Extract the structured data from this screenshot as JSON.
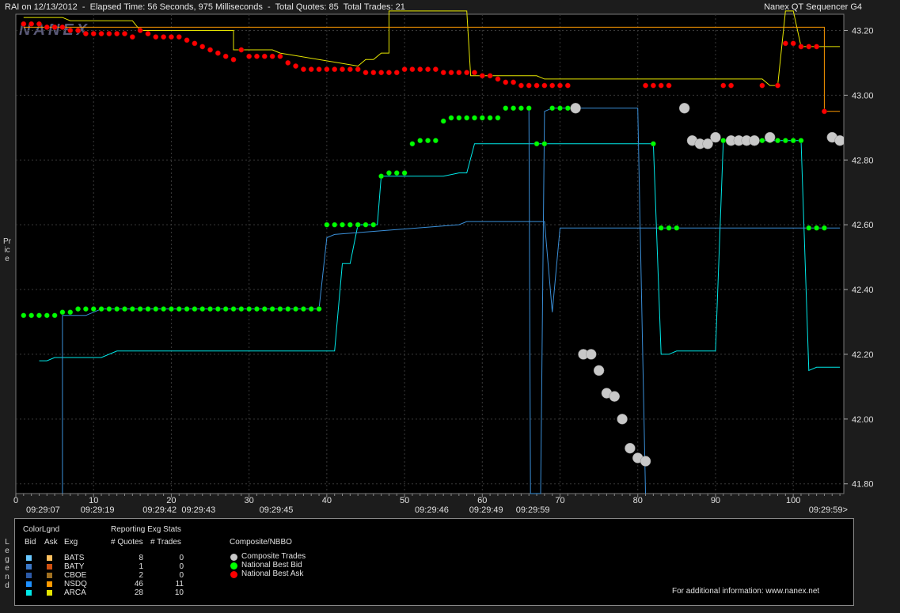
{
  "header": {
    "left": "RAI on 12/13/2012  -  Elapsed Time: 56 Seconds, 975 Milliseconds  -  Total Quotes: 85  Total Trades: 21",
    "right": "Nanex QT Sequencer G4"
  },
  "watermark": "NANEX",
  "side_labels": {
    "price": "Price",
    "legend": "Legend"
  },
  "chart_data": {
    "type": "line",
    "ylim": [
      41.77,
      43.25
    ],
    "xlim": [
      0,
      106.5
    ],
    "y_ticks": [
      "43.20",
      "43.00",
      "42.80",
      "42.60",
      "42.40",
      "42.20",
      "42.00",
      "41.80"
    ],
    "x_ticks": [
      "0",
      "10",
      "20",
      "30",
      "40",
      "50",
      "60",
      "70",
      "80",
      "90",
      "100"
    ],
    "time_labels": [
      {
        "x": 3.5,
        "label": "09:29:07"
      },
      {
        "x": 10.5,
        "label": "09:29:19"
      },
      {
        "x": 18.5,
        "label": "09:29:42"
      },
      {
        "x": 23.5,
        "label": "09:29:43"
      },
      {
        "x": 33.5,
        "label": "09:29:45"
      },
      {
        "x": 53.5,
        "label": "09:29:46"
      },
      {
        "x": 60.5,
        "label": "09:29:49"
      },
      {
        "x": 66.5,
        "label": "09:29:59"
      },
      {
        "x": 104.5,
        "label": "09:29:59>"
      }
    ],
    "national_best_ask": {
      "name": "National Best Ask",
      "color": "#ff0000",
      "points": [
        [
          1,
          43.22
        ],
        [
          2,
          43.22
        ],
        [
          3,
          43.22
        ],
        [
          4,
          43.21
        ],
        [
          5,
          43.21
        ],
        [
          6,
          43.21
        ],
        [
          7,
          43.2
        ],
        [
          8,
          43.2
        ],
        [
          9,
          43.19
        ],
        [
          10,
          43.19
        ],
        [
          11,
          43.19
        ],
        [
          12,
          43.19
        ],
        [
          13,
          43.19
        ],
        [
          14,
          43.19
        ],
        [
          15,
          43.18
        ],
        [
          16,
          43.2
        ],
        [
          17,
          43.19
        ],
        [
          18,
          43.18
        ],
        [
          19,
          43.18
        ],
        [
          20,
          43.18
        ],
        [
          21,
          43.18
        ],
        [
          22,
          43.17
        ],
        [
          23,
          43.16
        ],
        [
          24,
          43.15
        ],
        [
          25,
          43.14
        ],
        [
          26,
          43.13
        ],
        [
          27,
          43.12
        ],
        [
          28,
          43.11
        ],
        [
          29,
          43.14
        ],
        [
          30,
          43.12
        ],
        [
          31,
          43.12
        ],
        [
          32,
          43.12
        ],
        [
          33,
          43.12
        ],
        [
          34,
          43.12
        ],
        [
          35,
          43.1
        ],
        [
          36,
          43.09
        ],
        [
          37,
          43.08
        ],
        [
          38,
          43.08
        ],
        [
          39,
          43.08
        ],
        [
          40,
          43.08
        ],
        [
          41,
          43.08
        ],
        [
          42,
          43.08
        ],
        [
          43,
          43.08
        ],
        [
          44,
          43.08
        ],
        [
          45,
          43.07
        ],
        [
          46,
          43.07
        ],
        [
          47,
          43.07
        ],
        [
          48,
          43.07
        ],
        [
          49,
          43.07
        ],
        [
          50,
          43.08
        ],
        [
          51,
          43.08
        ],
        [
          52,
          43.08
        ],
        [
          53,
          43.08
        ],
        [
          54,
          43.08
        ],
        [
          55,
          43.07
        ],
        [
          56,
          43.07
        ],
        [
          57,
          43.07
        ],
        [
          58,
          43.07
        ],
        [
          59,
          43.07
        ],
        [
          60,
          43.06
        ],
        [
          61,
          43.06
        ],
        [
          62,
          43.05
        ],
        [
          63,
          43.04
        ],
        [
          64,
          43.04
        ],
        [
          65,
          43.03
        ],
        [
          66,
          43.03
        ],
        [
          67,
          43.03
        ],
        [
          68,
          43.03
        ],
        [
          69,
          43.03
        ],
        [
          70,
          43.03
        ],
        [
          71,
          43.03
        ],
        [
          81,
          43.03
        ],
        [
          82,
          43.03
        ],
        [
          83,
          43.03
        ],
        [
          84,
          43.03
        ],
        [
          91,
          43.03
        ],
        [
          92,
          43.03
        ],
        [
          96,
          43.03
        ],
        [
          98,
          43.03
        ],
        [
          99,
          43.16
        ],
        [
          100,
          43.16
        ],
        [
          101,
          43.15
        ],
        [
          102,
          43.15
        ],
        [
          103,
          43.15
        ],
        [
          104,
          42.95
        ]
      ]
    },
    "national_best_bid": {
      "name": "National Best Bid",
      "color": "#00ff00",
      "points": [
        [
          1,
          42.32
        ],
        [
          2,
          42.32
        ],
        [
          3,
          42.32
        ],
        [
          4,
          42.32
        ],
        [
          5,
          42.32
        ],
        [
          6,
          42.33
        ],
        [
          7,
          42.33
        ],
        [
          8,
          42.34
        ],
        [
          9,
          42.34
        ],
        [
          10,
          42.34
        ],
        [
          11,
          42.34
        ],
        [
          12,
          42.34
        ],
        [
          13,
          42.34
        ],
        [
          14,
          42.34
        ],
        [
          15,
          42.34
        ],
        [
          16,
          42.34
        ],
        [
          17,
          42.34
        ],
        [
          18,
          42.34
        ],
        [
          19,
          42.34
        ],
        [
          20,
          42.34
        ],
        [
          21,
          42.34
        ],
        [
          22,
          42.34
        ],
        [
          23,
          42.34
        ],
        [
          24,
          42.34
        ],
        [
          25,
          42.34
        ],
        [
          26,
          42.34
        ],
        [
          27,
          42.34
        ],
        [
          28,
          42.34
        ],
        [
          29,
          42.34
        ],
        [
          30,
          42.34
        ],
        [
          31,
          42.34
        ],
        [
          32,
          42.34
        ],
        [
          33,
          42.34
        ],
        [
          34,
          42.34
        ],
        [
          35,
          42.34
        ],
        [
          36,
          42.34
        ],
        [
          37,
          42.34
        ],
        [
          38,
          42.34
        ],
        [
          39,
          42.34
        ],
        [
          40,
          42.6
        ],
        [
          41,
          42.6
        ],
        [
          42,
          42.6
        ],
        [
          43,
          42.6
        ],
        [
          44,
          42.6
        ],
        [
          45,
          42.6
        ],
        [
          46,
          42.6
        ],
        [
          47,
          42.75
        ],
        [
          48,
          42.76
        ],
        [
          49,
          42.76
        ],
        [
          50,
          42.76
        ],
        [
          51,
          42.85
        ],
        [
          52,
          42.86
        ],
        [
          53,
          42.86
        ],
        [
          54,
          42.86
        ],
        [
          55,
          42.92
        ],
        [
          56,
          42.93
        ],
        [
          57,
          42.93
        ],
        [
          58,
          42.93
        ],
        [
          59,
          42.93
        ],
        [
          60,
          42.93
        ],
        [
          61,
          42.93
        ],
        [
          62,
          42.93
        ],
        [
          63,
          42.96
        ],
        [
          64,
          42.96
        ],
        [
          65,
          42.96
        ],
        [
          66,
          42.96
        ],
        [
          67,
          42.85
        ],
        [
          68,
          42.85
        ],
        [
          69,
          42.96
        ],
        [
          70,
          42.96
        ],
        [
          71,
          42.96
        ],
        [
          82,
          42.85
        ],
        [
          83,
          42.59
        ],
        [
          84,
          42.59
        ],
        [
          85,
          42.59
        ],
        [
          91,
          42.86
        ],
        [
          92,
          42.86
        ],
        [
          93,
          42.86
        ],
        [
          94,
          42.86
        ],
        [
          95,
          42.86
        ],
        [
          96,
          42.86
        ],
        [
          97,
          42.86
        ],
        [
          98,
          42.86
        ],
        [
          99,
          42.86
        ],
        [
          100,
          42.86
        ],
        [
          101,
          42.86
        ],
        [
          102,
          42.59
        ],
        [
          103,
          42.59
        ],
        [
          104,
          42.59
        ]
      ]
    },
    "composite_trades": {
      "name": "Composite Trades",
      "color": "#c8c8c8",
      "points": [
        [
          72,
          42.96
        ],
        [
          73,
          42.2
        ],
        [
          74,
          42.2
        ],
        [
          75,
          42.15
        ],
        [
          76,
          42.08
        ],
        [
          77,
          42.07
        ],
        [
          78,
          42.0
        ],
        [
          79,
          41.91
        ],
        [
          80,
          41.88
        ],
        [
          81,
          41.87
        ],
        [
          86,
          42.96
        ],
        [
          87,
          42.86
        ],
        [
          88,
          42.85
        ],
        [
          89,
          42.85
        ],
        [
          90,
          42.87
        ],
        [
          92,
          42.86
        ],
        [
          93,
          42.86
        ],
        [
          94,
          42.86
        ],
        [
          95,
          42.86
        ],
        [
          97,
          42.87
        ],
        [
          105,
          42.87
        ],
        [
          106,
          42.86
        ]
      ]
    },
    "exchange_lines": [
      {
        "exg": "ARCA",
        "side": "ask",
        "color": "#e6e600",
        "points": [
          [
            1,
            43.24
          ],
          [
            6,
            43.24
          ],
          [
            7,
            43.23
          ],
          [
            15,
            43.23
          ],
          [
            16,
            43.2
          ],
          [
            28,
            43.2
          ],
          [
            28,
            43.14
          ],
          [
            33,
            43.14
          ],
          [
            34,
            43.13
          ],
          [
            44,
            43.09
          ],
          [
            45,
            43.11
          ],
          [
            46,
            43.11
          ],
          [
            47,
            43.13
          ],
          [
            48,
            43.13
          ],
          [
            48,
            43.26
          ],
          [
            58,
            43.26
          ],
          [
            58.5,
            43.06
          ],
          [
            67,
            43.06
          ],
          [
            68,
            43.05
          ],
          [
            96,
            43.05
          ],
          [
            97,
            43.03
          ],
          [
            98,
            43.03
          ],
          [
            99,
            43.26
          ],
          [
            100,
            43.26
          ],
          [
            101,
            43.15
          ],
          [
            106,
            43.15
          ]
        ]
      },
      {
        "exg": "NSDQ",
        "side": "ask",
        "color": "#ff9a00",
        "points": [
          [
            1,
            43.21
          ],
          [
            103,
            43.21
          ],
          [
            104,
            43.21
          ],
          [
            104,
            42.95
          ],
          [
            106,
            42.95
          ]
        ]
      },
      {
        "exg": "ARCA",
        "side": "bid",
        "color": "#00e8e8",
        "points": [
          [
            3,
            42.18
          ],
          [
            4,
            42.18
          ],
          [
            5,
            42.19
          ],
          [
            11,
            42.19
          ],
          [
            13,
            42.21
          ],
          [
            41,
            42.21
          ],
          [
            42,
            42.48
          ],
          [
            43,
            42.48
          ],
          [
            44,
            42.6
          ],
          [
            46,
            42.6
          ],
          [
            46.5,
            42.6
          ],
          [
            47,
            42.75
          ],
          [
            55,
            42.75
          ],
          [
            57,
            42.76
          ],
          [
            58,
            42.76
          ],
          [
            59,
            42.85
          ],
          [
            82,
            42.85
          ],
          [
            83,
            42.2
          ],
          [
            84,
            42.2
          ],
          [
            85,
            42.21
          ],
          [
            90,
            42.21
          ],
          [
            91,
            42.86
          ],
          [
            101,
            42.86
          ],
          [
            102,
            42.15
          ],
          [
            103,
            42.16
          ],
          [
            106,
            42.16
          ]
        ]
      },
      {
        "exg": "NSDQ",
        "side": "bid",
        "color": "#3a8fd8",
        "points": [
          [
            6,
            41.77
          ],
          [
            6,
            42.32
          ],
          [
            9,
            42.32
          ],
          [
            11,
            42.34
          ],
          [
            39,
            42.34
          ],
          [
            40,
            42.56
          ],
          [
            41,
            42.57
          ],
          [
            57,
            42.6
          ],
          [
            58,
            42.61
          ],
          [
            68,
            42.61
          ],
          [
            69,
            42.33
          ],
          [
            70,
            42.59
          ],
          [
            106,
            42.59
          ]
        ]
      },
      {
        "exg": "BATS",
        "side": "bid",
        "color": "#3a8fd8",
        "points": [
          [
            66,
            42.96
          ],
          [
            66.2,
            41.77
          ],
          [
            67.5,
            41.77
          ],
          [
            68,
            42.95
          ],
          [
            69,
            42.96
          ],
          [
            80,
            42.96
          ],
          [
            81,
            41.77
          ]
        ]
      }
    ]
  },
  "legend": {
    "color_legend_title": "ColorLgnd",
    "bid_col": "Bid",
    "ask_col": "Ask",
    "exg_col": "Exg",
    "stats_title": "Reporting Exg Stats",
    "quotes_col": "# Quotes",
    "trades_col": "# Trades",
    "rows": [
      {
        "exg": "BATS",
        "quotes": "8",
        "trades": "0",
        "bid_color": "#6ac8ff",
        "ask_color": "#ffc060"
      },
      {
        "exg": "BATY",
        "quotes": "1",
        "trades": "0",
        "bid_color": "#3a78c8",
        "ask_color": "#d05010"
      },
      {
        "exg": "CBOE",
        "quotes": "2",
        "trades": "0",
        "bid_color": "#2c5aa8",
        "ask_color": "#a07020"
      },
      {
        "exg": "NSDQ",
        "quotes": "46",
        "trades": "11",
        "bid_color": "#1e90ff",
        "ask_color": "#ff9a00"
      },
      {
        "exg": "ARCA",
        "quotes": "28",
        "trades": "10",
        "bid_color": "#00e8e8",
        "ask_color": "#e6e600"
      }
    ],
    "composite_title": "Composite/NBBO",
    "composite_items": [
      {
        "label": "Composite Trades",
        "color": "#c8c8c8"
      },
      {
        "label": "National Best Bid",
        "color": "#00ff00"
      },
      {
        "label": "National Best Ask",
        "color": "#ff0000"
      }
    ],
    "footer": "For additional information: www.nanex.net"
  }
}
